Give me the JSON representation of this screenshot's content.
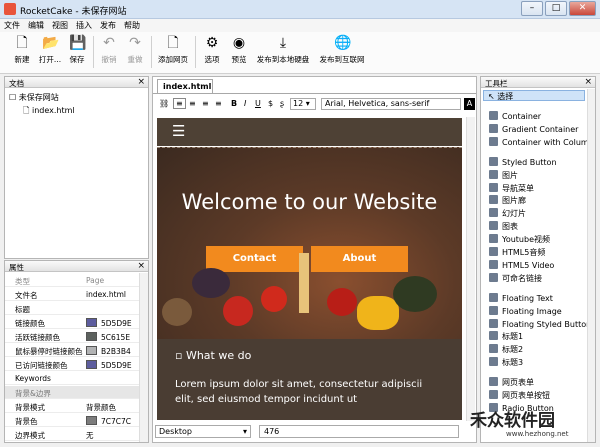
{
  "window": {
    "title": "RocketCake - 未保存网站"
  },
  "menu": [
    "文件",
    "编辑",
    "视图",
    "插入",
    "发布",
    "帮助"
  ],
  "toolbar": {
    "new": "新建",
    "open": "打开...",
    "save": "保存",
    "undo": "撤销",
    "redo": "重做",
    "add_page": "添加网页",
    "options": "选项",
    "preview": "预览",
    "publish_disk": "发布到本地硬盘",
    "publish_web": "发布到互联网"
  },
  "documents": {
    "title": "文档",
    "root": "未保存网站",
    "child": "index.html"
  },
  "properties": {
    "title": "属性",
    "header": {
      "key": "类型",
      "value": "Page"
    },
    "rows": [
      {
        "k": "文件名",
        "v": "index.html",
        "c": ""
      },
      {
        "k": "标题",
        "v": "",
        "c": ""
      },
      {
        "k": "链接颜色",
        "v": "5D5D9E",
        "c": "#5D5D9E"
      },
      {
        "k": "活跃链接颜色",
        "v": "5C615E",
        "c": "#5C615E"
      },
      {
        "k": "鼠标暴停时链接颜色",
        "v": "B2B3B4",
        "c": "#B2B3B4"
      },
      {
        "k": "已访问链接颜色",
        "v": "5D5D9E",
        "c": "#5D5D9E"
      },
      {
        "k": "Keywords",
        "v": "",
        "c": ""
      }
    ],
    "section": "背景&边界",
    "rows2": [
      {
        "k": "背景模式",
        "v": "背景颜色",
        "c": ""
      },
      {
        "k": "背景色",
        "v": "7C7C7C",
        "c": "#7C7C7C"
      },
      {
        "k": "边界模式",
        "v": "无",
        "c": ""
      }
    ]
  },
  "editor": {
    "tab": "index.html",
    "font_size": "12",
    "font_family": "Arial, Helvetica, sans-serif",
    "hero_title": "Welcome to our Website",
    "btn_contact": "Contact",
    "btn_about": "About",
    "section_heading": "What we do",
    "lorem": "Lorem ipsum dolor sit amet, consectetur adipiscii elit, sed eiusmod tempor incidunt ut",
    "menu_glyph": "☰",
    "device": "Desktop",
    "width": "476"
  },
  "toolbox": {
    "title": "工具栏",
    "select": "选择",
    "groups": [
      [
        "Container",
        "Gradient Container",
        "Container with Columns"
      ],
      [
        "Styled Button",
        "图片",
        "导航菜单",
        "图片廊",
        "幻灯片",
        "图表",
        "Youtube视频",
        "HTML5音频",
        "HTML5 Video",
        "可命名链接"
      ],
      [
        "Floating Text",
        "Floating Image",
        "Floating Styled Button",
        "标题1",
        "标题2",
        "标题3"
      ],
      [
        "网页表单",
        "网页表单按钮",
        "Radio Button"
      ]
    ]
  },
  "watermark": {
    "name": "禾众软件园",
    "url": "www.hezhong.net"
  },
  "colors": {
    "accent_orange": "#f28a1e",
    "dark_brown": "#4a3d33"
  }
}
